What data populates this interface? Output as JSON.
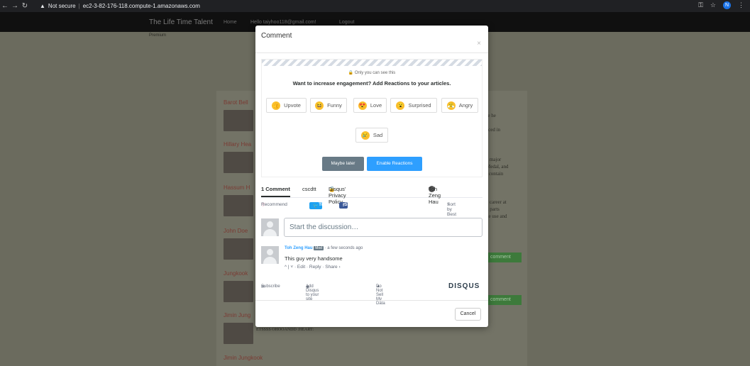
{
  "browser": {
    "security": "Not secure",
    "url": "ec2-3-82-176-118.compute-1.amazonaws.com",
    "profile_initial": "N"
  },
  "site": {
    "brand": "The Life Time Talent",
    "nav": [
      "Home",
      "Hello taiyhoo118@gmail.com!",
      "Logout"
    ],
    "premium": "Premium"
  },
  "people": [
    {
      "name": "Barot Bell"
    },
    {
      "name": "Hillary Hea"
    },
    {
      "name": "Hassum H"
    },
    {
      "name": "John Doe"
    },
    {
      "name": "Jungkook"
    },
    {
      "name": "Jimin Jung"
    },
    {
      "name": "Jimin Jungkook"
    }
  ],
  "side_snippets": {
    "s1": [
      "re he",
      "s",
      "aced in"
    ],
    "s2": [
      "e major",
      "Medal, and",
      "l contain"
    ],
    "s3": [
      "e career at",
      "d parts",
      "he use and"
    ],
    "comment_btn": "comment",
    "body": "ETSSSS OHOOANDD :HEART:"
  },
  "modal": {
    "title": "Comment",
    "close": "×",
    "only_you": "Only you can see this",
    "promo": "Want to increase engagement? Add Reactions to your articles.",
    "reactions": [
      {
        "label": "Upvote",
        "emoji": "👍"
      },
      {
        "label": "Funny",
        "emoji": "😆"
      },
      {
        "label": "Love",
        "emoji": "😍"
      },
      {
        "label": "Surprised",
        "emoji": "😮"
      },
      {
        "label": "Angry",
        "emoji": "😤"
      },
      {
        "label": "Sad",
        "emoji": "😢"
      }
    ],
    "maybe_later": "Maybe later",
    "enable_reactions": "Enable Reactions",
    "tabs": {
      "comments": "1 Comment",
      "site": "cscdtt",
      "privacy": "Disqus' Privacy Policy",
      "user": "Toh Zeng Hau"
    },
    "recommend": "Recommend",
    "tweet": "Tweet",
    "share": "Share",
    "sort": "Sort by Best",
    "input_placeholder": "Start the discussion…",
    "comment": {
      "author": "Toh Zeng Hau",
      "badge": "Mod",
      "time": "· a few seconds ago",
      "text": "This guy very handsome",
      "actions": "^ | ˅ · Edit · Reply · Share ›"
    },
    "footer": {
      "subscribe": "Subscribe",
      "add_disqus": "Add Disqus to your site",
      "do_not_sell": "Do Not Sell My Data",
      "logo": "DISQUS"
    },
    "cancel": "Cancel"
  }
}
